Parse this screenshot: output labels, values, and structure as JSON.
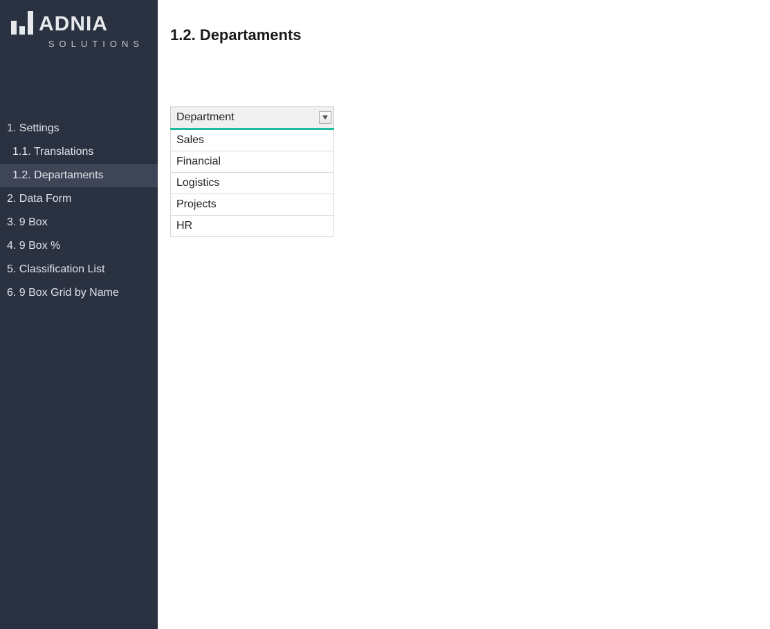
{
  "brand": {
    "name": "ADNIA",
    "sub": "SOLUTIONS"
  },
  "sidebar": {
    "items": [
      {
        "label": "1. Settings",
        "child": false,
        "active": false
      },
      {
        "label": "1.1. Translations",
        "child": true,
        "active": false
      },
      {
        "label": "1.2. Departaments",
        "child": true,
        "active": true
      },
      {
        "label": "2. Data Form",
        "child": false,
        "active": false
      },
      {
        "label": "3. 9 Box",
        "child": false,
        "active": false
      },
      {
        "label": "4. 9 Box %",
        "child": false,
        "active": false
      },
      {
        "label": "5. Classification List",
        "child": false,
        "active": false
      },
      {
        "label": "6. 9 Box Grid by Name",
        "child": false,
        "active": false
      }
    ]
  },
  "page": {
    "title": "1.2. Departaments"
  },
  "table": {
    "header": "Department",
    "rows": [
      "Sales",
      "Financial",
      "Logistics",
      "Projects",
      "HR"
    ]
  },
  "colors": {
    "sidebar_bg": "#2a3140",
    "accent": "#1fbba0"
  }
}
